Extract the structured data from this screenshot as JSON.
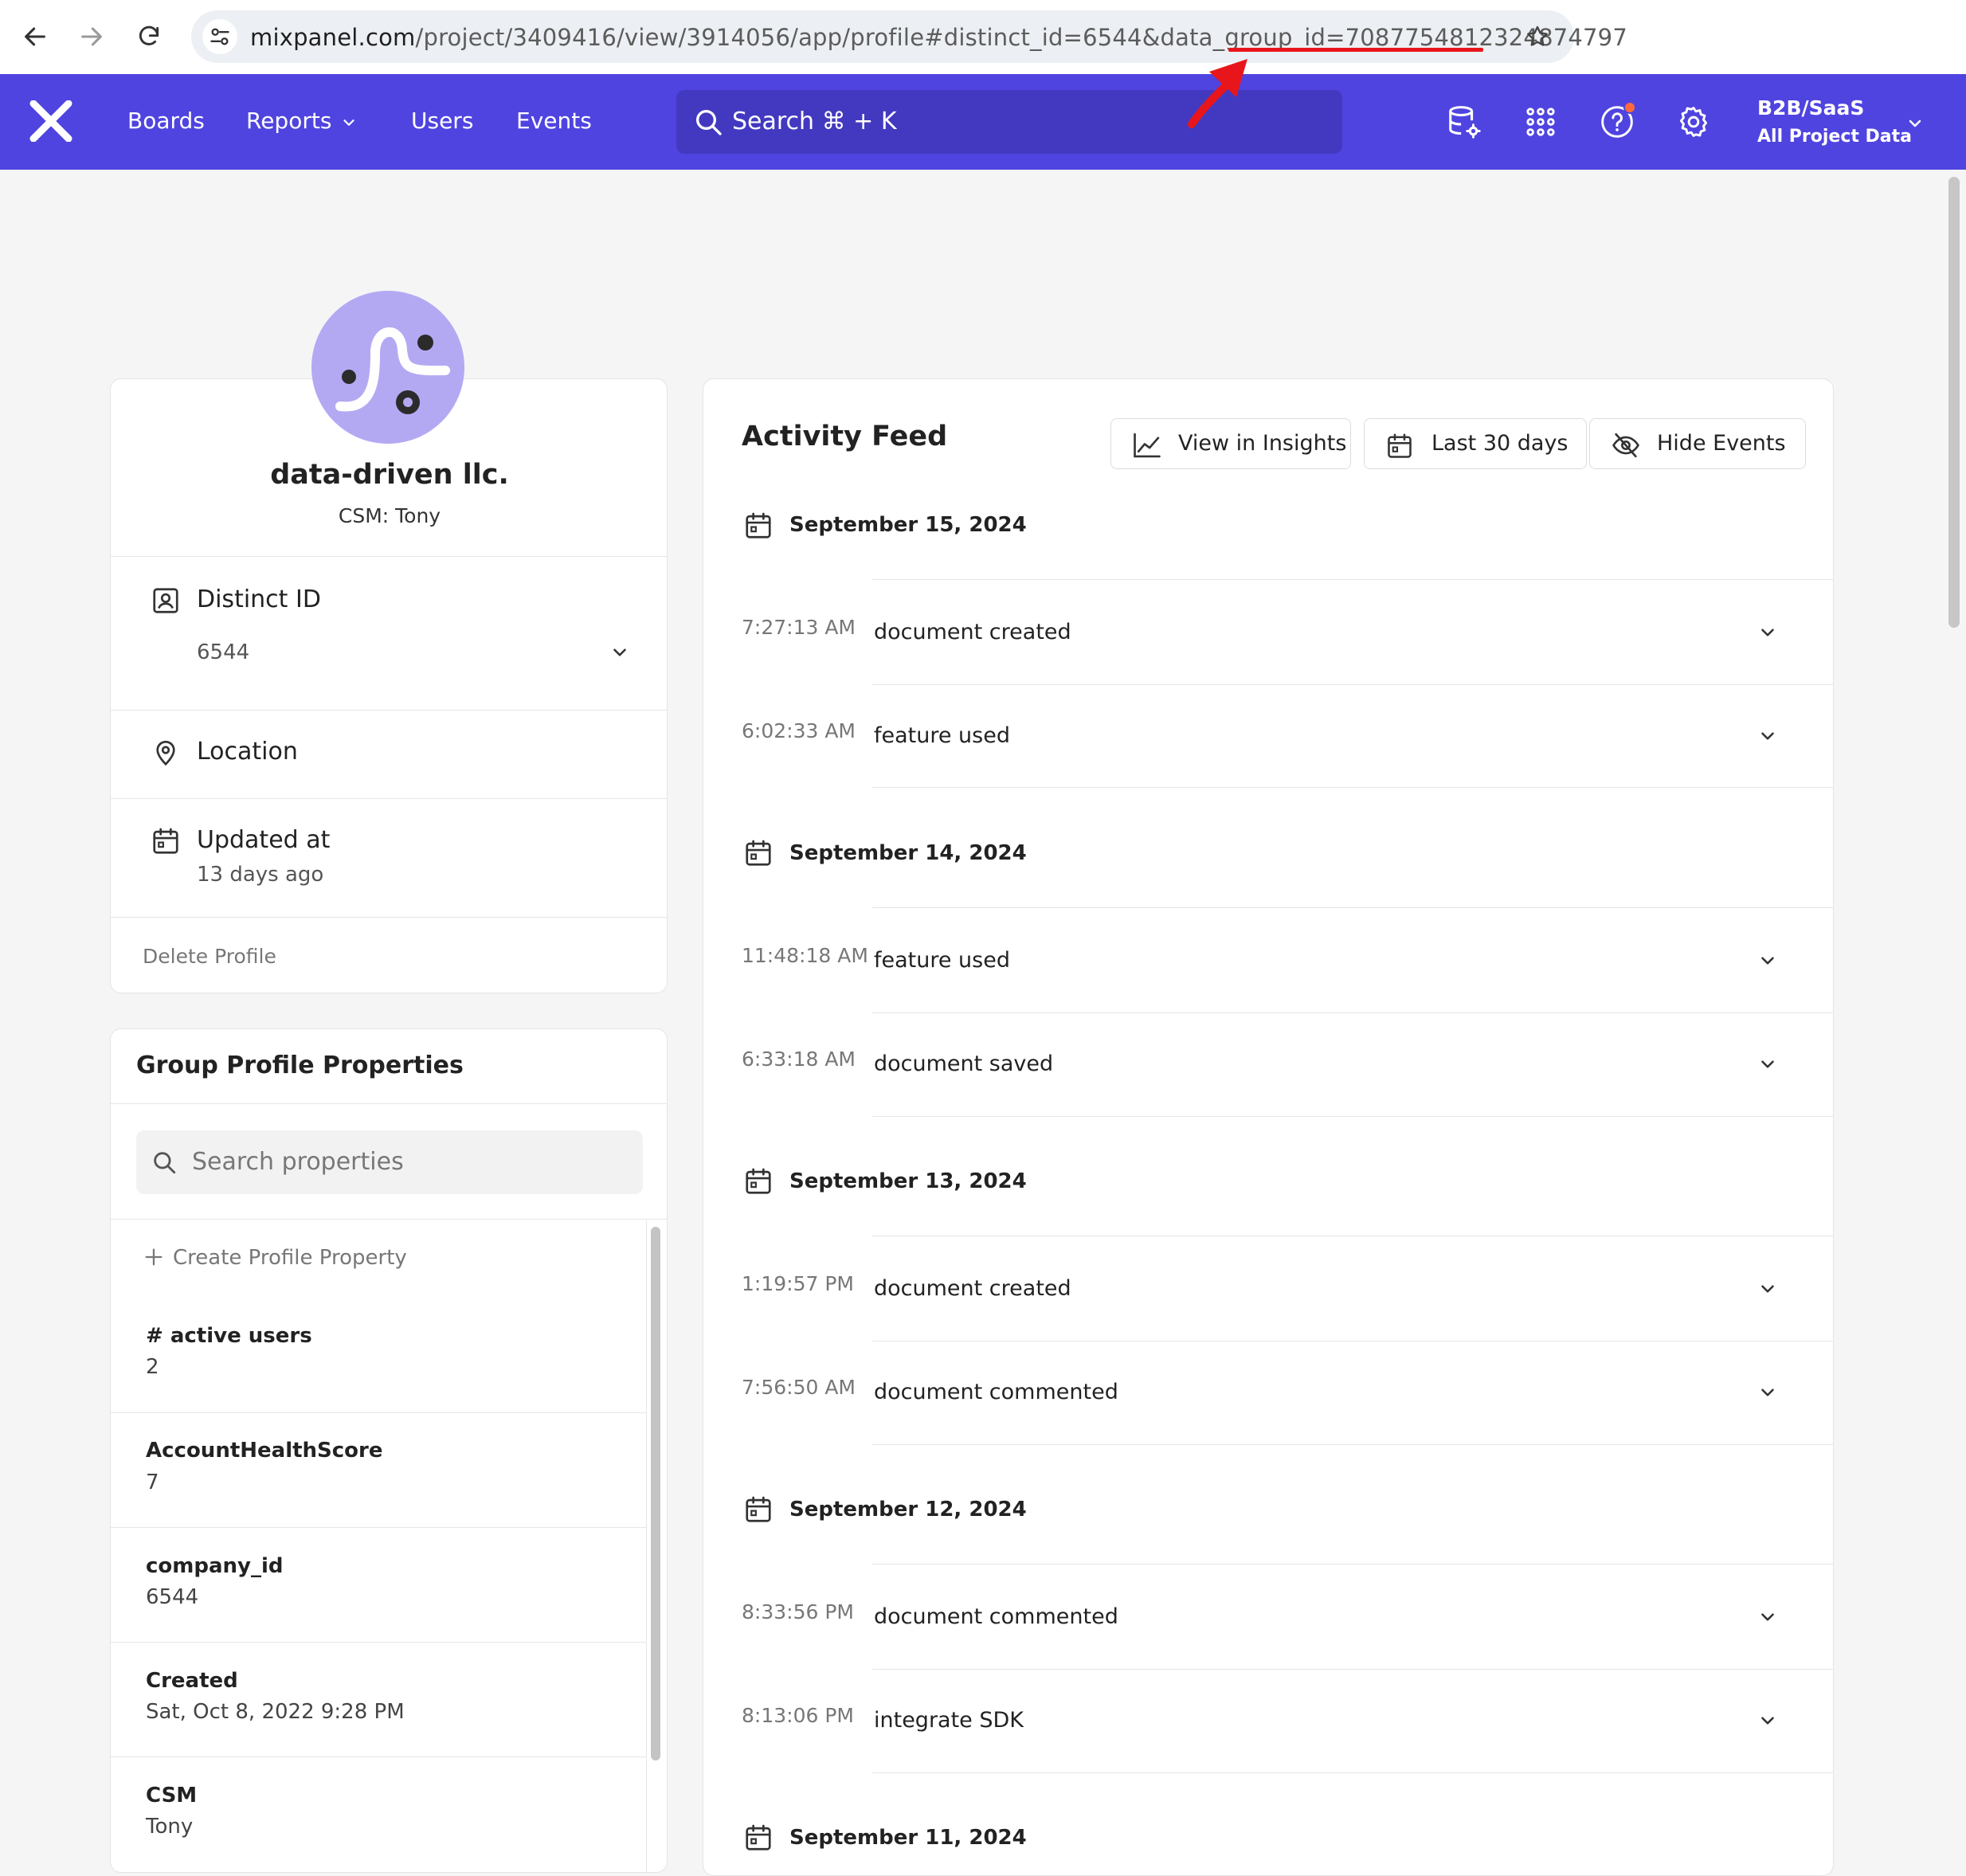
{
  "browser": {
    "url_domain": "mixpanel.com",
    "url_path": "/project/3409416/view/3914056/app/profile#distinct_id=6544&data_group_id=",
    "url_highlight": "7087754812324874797"
  },
  "header": {
    "nav": [
      "Boards",
      "Reports",
      "Users",
      "Events"
    ],
    "search_label": "Search",
    "search_shortcut": "⌘ + K",
    "project_name": "B2B/SaaS",
    "project_sub": "All Project Data"
  },
  "profile": {
    "name": "data-driven llc.",
    "subtitle": "CSM: Tony",
    "distinct_id_label": "Distinct ID",
    "distinct_id_value": "6544",
    "location_label": "Location",
    "updated_label": "Updated at",
    "updated_value": "13 days ago",
    "delete_label": "Delete Profile"
  },
  "group": {
    "title": "Group Profile Properties",
    "search_placeholder": "Search properties",
    "create_label": "Create Profile Property",
    "properties": [
      {
        "name": "# active users",
        "value": "2"
      },
      {
        "name": "AccountHealthScore",
        "value": "7"
      },
      {
        "name": "company_id",
        "value": "6544"
      },
      {
        "name": "Created",
        "value": "Sat, Oct 8, 2022 9:28 PM"
      },
      {
        "name": "CSM",
        "value": "Tony"
      }
    ]
  },
  "feed": {
    "title": "Activity Feed",
    "btn_insights": "View in Insights",
    "btn_range": "Last 30 days",
    "btn_hide": "Hide Events",
    "days": [
      {
        "date": "September 15, 2024",
        "events": [
          {
            "time": "7:27:13 AM",
            "name": "document created"
          },
          {
            "time": "6:02:33 AM",
            "name": "feature used"
          }
        ]
      },
      {
        "date": "September 14, 2024",
        "events": [
          {
            "time": "11:48:18 AM",
            "name": "feature used"
          },
          {
            "time": "6:33:18 AM",
            "name": "document saved"
          }
        ]
      },
      {
        "date": "September 13, 2024",
        "events": [
          {
            "time": "1:19:57 PM",
            "name": "document created"
          },
          {
            "time": "7:56:50 AM",
            "name": "document commented"
          }
        ]
      },
      {
        "date": "September 12, 2024",
        "events": [
          {
            "time": "8:33:56 PM",
            "name": "document commented"
          },
          {
            "time": "8:13:06 PM",
            "name": "integrate SDK"
          }
        ]
      },
      {
        "date": "September 11, 2024",
        "events": []
      }
    ]
  },
  "colors": {
    "brand": "#4f44e0",
    "search_bg": "#4339c0",
    "avatar_bg": "#b3a9f3",
    "annotation": "#e8161b",
    "notification": "#ff6a3d"
  }
}
